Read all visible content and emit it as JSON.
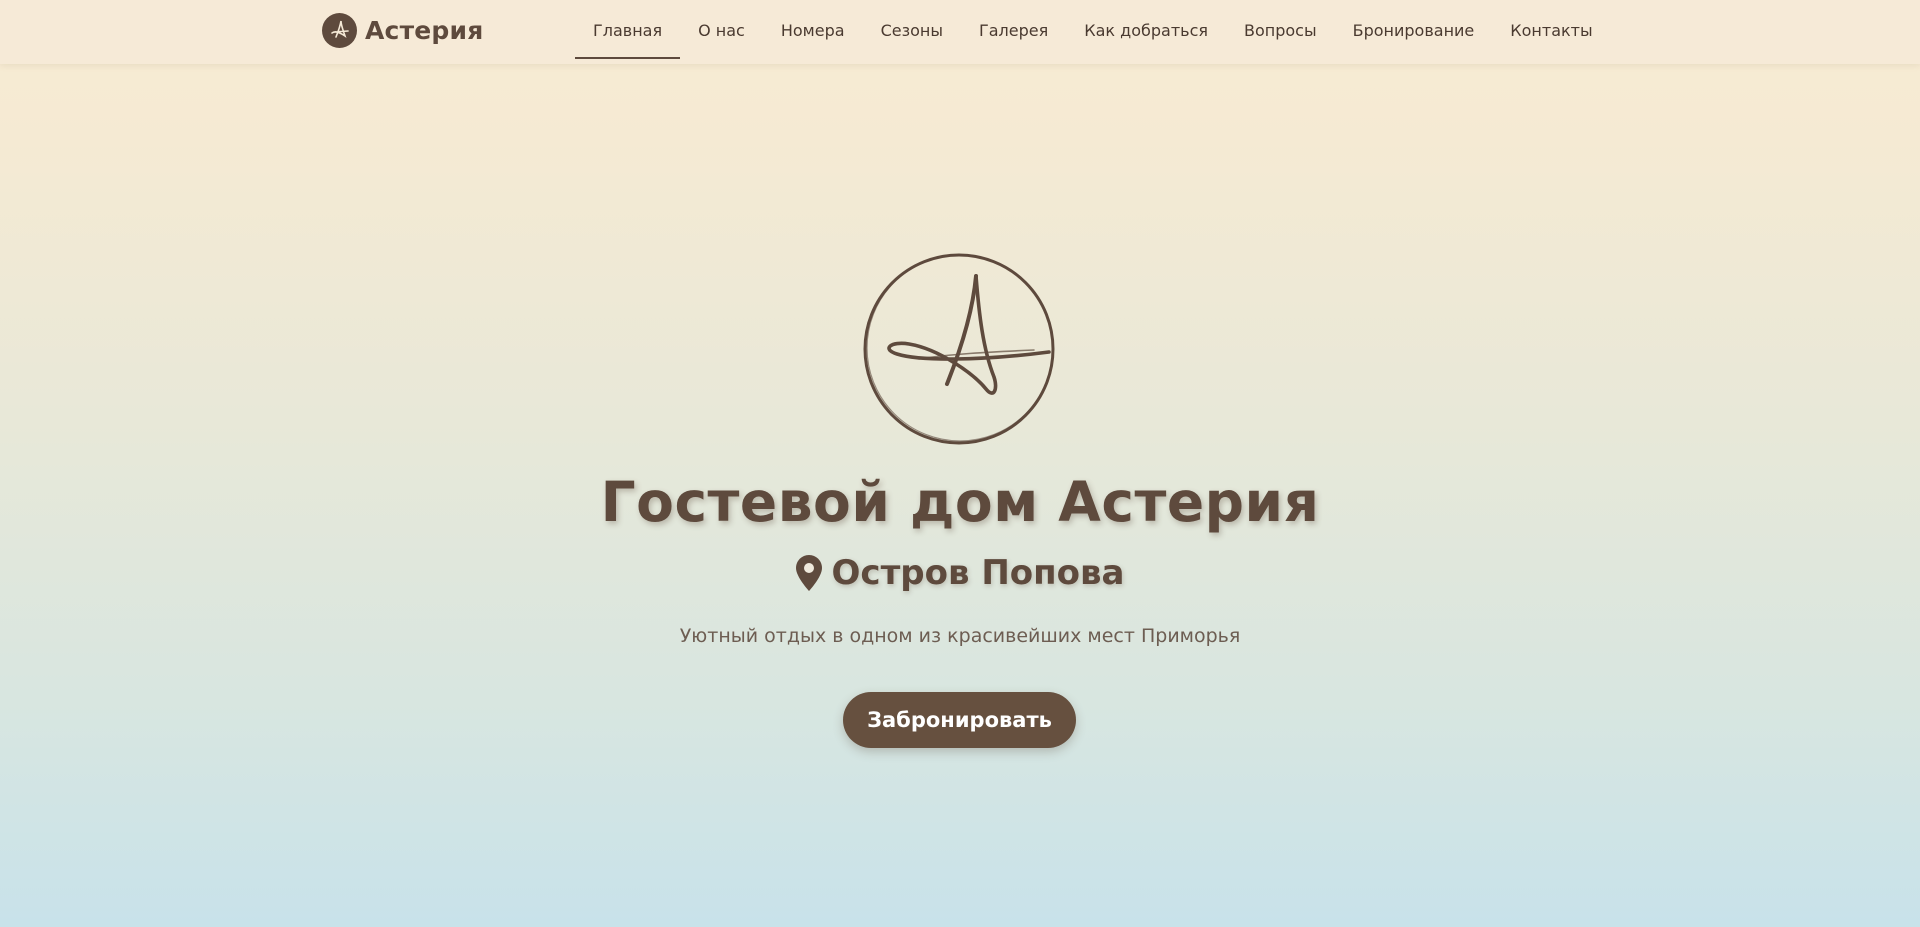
{
  "header": {
    "brand_name": "Астерия",
    "brand_logo_icon": "asteria-logo-icon",
    "nav": [
      {
        "label": "Главная",
        "active": true
      },
      {
        "label": "О нас"
      },
      {
        "label": "Номера"
      },
      {
        "label": "Сезоны"
      },
      {
        "label": "Галерея"
      },
      {
        "label": "Как добраться"
      },
      {
        "label": "Вопросы"
      },
      {
        "label": "Бронирование"
      },
      {
        "label": "Контакты"
      }
    ]
  },
  "hero": {
    "emblem_icon": "asteria-emblem-icon",
    "title": "Гостевой дом Астерия",
    "location_icon": "map-pin-icon",
    "location": "Остров Попова",
    "tagline": "Уютный отдых в одном из красивейших мест Приморья",
    "cta_label": "Забронировать"
  },
  "colors": {
    "brand": "#5e4a3d",
    "button": "#66503f",
    "navbar_bg": "#f6ead7",
    "gradient_top": "#f8ecd3",
    "gradient_bottom": "#c8e2ea"
  }
}
